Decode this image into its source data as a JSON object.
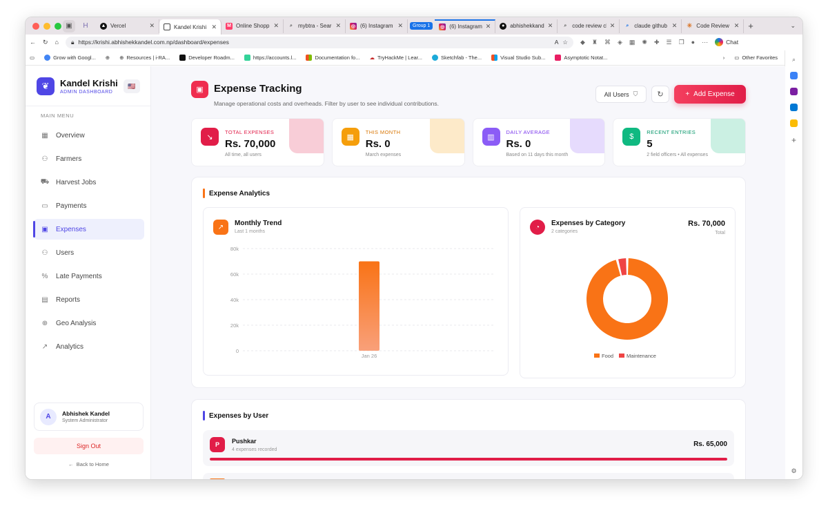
{
  "browser": {
    "tabs": [
      {
        "label": "Vercel",
        "active": false
      },
      {
        "label": "Kandel Krishi -",
        "active": true
      },
      {
        "label": "Online Shoppin",
        "active": false
      },
      {
        "label": "mybtra - Searc",
        "active": false
      },
      {
        "label": "(6) Instagram",
        "active": false
      },
      {
        "label": "(6) Instagram",
        "active": false
      },
      {
        "label": "abhishekkandel",
        "active": false
      },
      {
        "label": "code review cla",
        "active": false
      },
      {
        "label": "claude github a",
        "active": false
      },
      {
        "label": "Code Review -",
        "active": false
      }
    ],
    "group_label": "Group 1",
    "url": "https://krishi.abhishekkandel.com.np/dashboard/expenses",
    "chat_label": "Chat",
    "bookmarks": [
      "Grow with Googl...",
      "Resources | i-RA...",
      "Developer Roadm...",
      "https://accounts.l...",
      "Documentation fo...",
      "TryHackMe | Lear...",
      "Sketchfab - The...",
      "Visual Studio Sub...",
      "Asymptotic Notat..."
    ],
    "other_favorites": "Other Favorites"
  },
  "sidebar": {
    "brand_name": "Kandel Krishi",
    "brand_sub": "ADMIN DASHBOARD",
    "flag": "🇺🇸",
    "menu_label": "MAIN MENU",
    "items": [
      {
        "label": "Overview",
        "icon": "grid-icon"
      },
      {
        "label": "Farmers",
        "icon": "users-icon"
      },
      {
        "label": "Harvest Jobs",
        "icon": "truck-icon"
      },
      {
        "label": "Payments",
        "icon": "banknote-icon"
      },
      {
        "label": "Expenses",
        "icon": "wallet-icon"
      },
      {
        "label": "Users",
        "icon": "user-icon"
      },
      {
        "label": "Late Payments",
        "icon": "percent-icon"
      },
      {
        "label": "Reports",
        "icon": "report-icon"
      },
      {
        "label": "Geo Analysis",
        "icon": "globe-icon"
      },
      {
        "label": "Analytics",
        "icon": "trend-icon"
      }
    ],
    "active_index": 4,
    "user": {
      "initial": "A",
      "name": "Abhishek Kandel",
      "role": "System Administrator"
    },
    "sign_out": "Sign Out",
    "back_home": "Back to Home"
  },
  "header": {
    "title": "Expense Tracking",
    "subtitle": "Manage operational costs and overheads. Filter by user to see individual contributions.",
    "filter_label": "All Users",
    "add_label": "Add Expense"
  },
  "stats": [
    {
      "label": "TOTAL EXPENSES",
      "value": "Rs. 70,000",
      "sub": "All time, all users",
      "color": "#e11d48",
      "icon": "trend-down-icon"
    },
    {
      "label": "THIS MONTH",
      "value": "Rs. 0",
      "sub": "March expenses",
      "color": "#f59e0b",
      "icon": "calendar-icon"
    },
    {
      "label": "DAILY AVERAGE",
      "value": "Rs. 0",
      "sub": "Based on 11 days this month",
      "color": "#8b5cf6",
      "icon": "bar-chart-icon"
    },
    {
      "label": "RECENT ENTRIES",
      "value": "5",
      "sub": "2 field officers • All expenses",
      "color": "#10b981",
      "icon": "receipt-icon"
    }
  ],
  "analytics": {
    "title": "Expense Analytics",
    "trend_title": "Monthly Trend",
    "trend_sub": "Last 1 months",
    "category_title": "Expenses by Category",
    "category_sub": "2 categories",
    "category_total": "Rs. 70,000",
    "category_total_label": "Total"
  },
  "chart_data": [
    {
      "type": "bar",
      "categories": [
        "Jan 26"
      ],
      "values": [
        70000
      ],
      "yticks": [
        "0",
        "20k",
        "40k",
        "60k",
        "80k"
      ],
      "ylim": [
        0,
        80000
      ],
      "grid": true
    },
    {
      "type": "pie",
      "labels": [
        "Food",
        "Maintenance"
      ],
      "values": [
        67200,
        2800
      ],
      "colors": [
        "#f97316",
        "#ef4444"
      ],
      "legend": "bottom"
    }
  ],
  "by_user": {
    "title": "Expenses by User",
    "users": [
      {
        "initial": "P",
        "name": "Pushkar",
        "count": "4 expenses recorded",
        "amount": "Rs. 65,000",
        "share": 1.0
      }
    ]
  }
}
